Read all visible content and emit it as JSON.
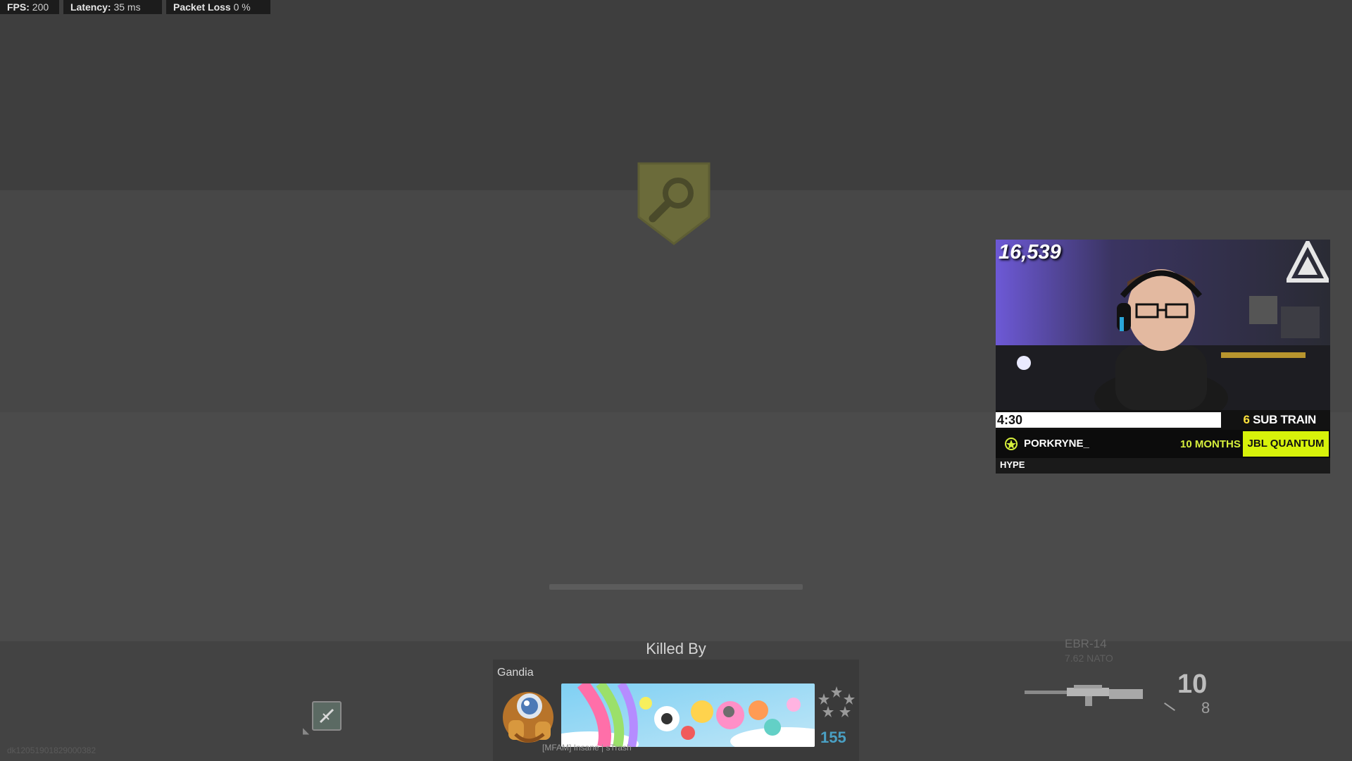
{
  "perf": {
    "fps_label": "FPS:",
    "fps_value": "200",
    "latency_label": "Latency:",
    "latency_value": "35 ms",
    "loss_label": "Packet Loss",
    "loss_value": "0 %"
  },
  "icons": {
    "objective": "search-shield-icon",
    "tactical": "tactical-icon",
    "weapon": "rifle-icon",
    "prestige": "prestige-stars-icon"
  },
  "respawn": {
    "progress": 0
  },
  "killcam": {
    "title": "Killed By",
    "player_name": "Gandia",
    "clan": "[MFAM] Insane | sTrash",
    "level": "155",
    "level_color": "#4aa0c4"
  },
  "bottom_id": "dk12051901829000382",
  "weapon": {
    "name": "EBR-14",
    "ammo_type": "7.62 NATO",
    "magazine": "10",
    "reserve": "8"
  },
  "stream_overlay": {
    "viewer_count": "16,539",
    "sub_timer": "4:30",
    "sub_train_count": "6",
    "sub_train_label": "SUB TRAIN",
    "subscriber": "PORKRYNE_",
    "months": "10 MONTHS",
    "sponsor": "JBL QUANTUM",
    "message": "HYPE",
    "brand_logo": "TEEP",
    "accent_color": "#d7f20a"
  }
}
